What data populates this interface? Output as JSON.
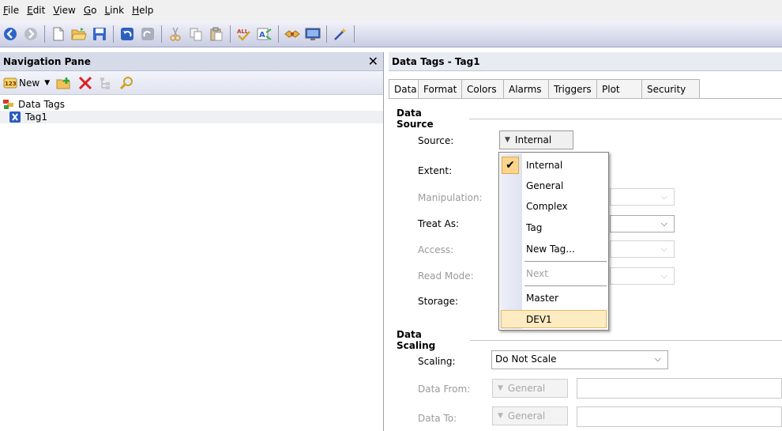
{
  "menubar": {
    "items": [
      {
        "label": "File",
        "key": "F",
        "rest": "ile"
      },
      {
        "label": "Edit",
        "key": "E",
        "rest": "dit"
      },
      {
        "label": "View",
        "key": "V",
        "rest": "iew"
      },
      {
        "label": "Go",
        "key": "G",
        "rest": "o"
      },
      {
        "label": "Link",
        "key": "L",
        "rest": "ink"
      },
      {
        "label": "Help",
        "key": "H",
        "rest": "elp"
      }
    ]
  },
  "toolbar": {
    "icons": [
      "back-icon",
      "forward-icon",
      "new-document-icon",
      "open-folder-icon",
      "save-icon",
      "undo-icon",
      "redo-icon",
      "cut-icon",
      "copy-icon",
      "paste-icon",
      "spell-check-icon",
      "replace-icon",
      "handshake-icon",
      "monitor-icon",
      "wand-icon"
    ]
  },
  "nav": {
    "title": "Navigation Pane",
    "new_label": "New",
    "tree": {
      "root_label": "Data Tags",
      "child_label": "Tag1"
    }
  },
  "panel": {
    "title": "Data Tags - Tag1",
    "tabs": [
      "Data",
      "Format",
      "Colors",
      "Alarms",
      "Triggers",
      "Plot",
      "Security"
    ],
    "data_source": {
      "section_label": "Data Source",
      "source_label": "Source:",
      "source_value": "Internal",
      "extent_label": "Extent:",
      "manipulation_label": "Manipulation:",
      "treat_as_label": "Treat As:",
      "access_label": "Access:",
      "read_mode_label": "Read Mode:",
      "storage_label": "Storage:"
    },
    "data_scaling": {
      "section_label": "Data Scaling",
      "scaling_label": "Scaling:",
      "scaling_value": "Do Not Scale",
      "data_from_label": "Data From:",
      "data_from_value": "General",
      "data_to_label": "Data To:",
      "data_to_value": "General"
    }
  },
  "dropdown": {
    "items": [
      {
        "label": "Internal",
        "checked": true,
        "disabled": false
      },
      {
        "label": "General",
        "checked": false,
        "disabled": false
      },
      {
        "label": "Complex",
        "checked": false,
        "disabled": false
      },
      {
        "label": "Tag",
        "checked": false,
        "disabled": false
      },
      {
        "label": "New Tag...",
        "checked": false,
        "disabled": false
      },
      {
        "label": "Next",
        "checked": false,
        "disabled": true
      },
      {
        "label": "Master",
        "checked": false,
        "disabled": false
      },
      {
        "label": "DEV1",
        "checked": false,
        "disabled": false,
        "highlighted": true
      }
    ]
  },
  "colors": {
    "toolbar_gradient_top": "#f3f3fa",
    "toolbar_gradient_bottom": "#c9cde3",
    "highlight": "#fdebc2",
    "check_bg": "#fbd58c"
  }
}
